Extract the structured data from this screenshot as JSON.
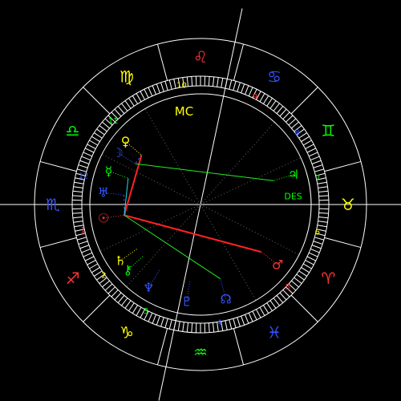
{
  "chart": {
    "ascendant_sign": "Scorpio",
    "signs": [
      {
        "name": "Aries",
        "glyph": "♈",
        "color": "#ff3333",
        "lon": 15
      },
      {
        "name": "Taurus",
        "glyph": "♉",
        "color": "#ffff00",
        "lon": 45
      },
      {
        "name": "Gemini",
        "glyph": "♊",
        "color": "#00ff00",
        "lon": 75
      },
      {
        "name": "Cancer",
        "glyph": "♋",
        "color": "#3355ff",
        "lon": 105
      },
      {
        "name": "Leo",
        "glyph": "♌",
        "color": "#ff3333",
        "lon": 135
      },
      {
        "name": "Virgo",
        "glyph": "♍",
        "color": "#ffff00",
        "lon": 165
      },
      {
        "name": "Libra",
        "glyph": "♎",
        "color": "#00ff00",
        "lon": 195
      },
      {
        "name": "Scorpio",
        "glyph": "♏",
        "color": "#3355ff",
        "lon": 225
      },
      {
        "name": "Sagittarius",
        "glyph": "♐",
        "color": "#ff3333",
        "lon": 255
      },
      {
        "name": "Capricorn",
        "glyph": "♑",
        "color": "#ffff00",
        "lon": 285
      },
      {
        "name": "Aquarius",
        "glyph": "♒",
        "color": "#00ff00",
        "lon": 315
      },
      {
        "name": "Pisces",
        "glyph": "♓",
        "color": "#3355ff",
        "lon": 345
      }
    ],
    "houses": [
      {
        "num": "1",
        "color": "#ff3333"
      },
      {
        "num": "2",
        "color": "#ffff00"
      },
      {
        "num": "3",
        "color": "#00ff00"
      },
      {
        "num": "4",
        "color": "#3355ff"
      },
      {
        "num": "5",
        "color": "#ff3333"
      },
      {
        "num": "6",
        "color": "#ffff00"
      },
      {
        "num": "7",
        "color": "#00ff00"
      },
      {
        "num": "8",
        "color": "#3355ff"
      },
      {
        "num": "9",
        "color": "#ff3333"
      },
      {
        "num": "10",
        "color": "#ffff00"
      },
      {
        "num": "11",
        "color": "#00ff00"
      },
      {
        "num": "12",
        "color": "#3355ff"
      }
    ],
    "angle_labels": [
      {
        "text": "MC",
        "color": "#ffff00",
        "role": "midheaven"
      },
      {
        "text": "DES",
        "color": "#00ff00",
        "role": "descendant"
      }
    ],
    "planets": [
      {
        "name": "Moon",
        "glyph": "☽",
        "color": "#3355ff"
      },
      {
        "name": "Venus",
        "glyph": "♀",
        "color": "#ffff00"
      },
      {
        "name": "Mercury",
        "glyph": "☿",
        "color": "#00ff00"
      },
      {
        "name": "Uranus",
        "glyph": "♅",
        "color": "#3355ff"
      },
      {
        "name": "Sun",
        "glyph": "☉",
        "color": "#ff3333"
      },
      {
        "name": "Saturn",
        "glyph": "♄",
        "color": "#ffff00"
      },
      {
        "name": "Chiron",
        "glyph": "⚷",
        "color": "#00ff00"
      },
      {
        "name": "Neptune",
        "glyph": "♆",
        "color": "#3355ff"
      },
      {
        "name": "Pluto",
        "glyph": "♇",
        "color": "#3355ff"
      },
      {
        "name": "Node",
        "glyph": "☊",
        "color": "#3355ff"
      },
      {
        "name": "Mars",
        "glyph": "♂",
        "color": "#ff3333"
      },
      {
        "name": "Jupiter",
        "glyph": "♃",
        "color": "#00ff00"
      }
    ],
    "aspects": [
      {
        "from": "Sun",
        "to": "Mars",
        "color": "#ff2222",
        "type": "square"
      },
      {
        "from": "Venus",
        "to": "Sun",
        "color": "#ff2222",
        "type": "square"
      },
      {
        "from": "Moon",
        "to": "Jupiter",
        "color": "#22ee22",
        "type": "sextile"
      },
      {
        "from": "Sun",
        "to": "Node",
        "color": "#22ee22",
        "type": "sextile"
      },
      {
        "from": "Mercury",
        "to": "Sun",
        "color": "#22dddd",
        "type": "opposition"
      },
      {
        "from": "Uranus",
        "to": "Sun",
        "color": "#4466ff",
        "type": "trine"
      },
      {
        "from": "Venus",
        "to": "Moon",
        "color": "#4466ff",
        "type": "minor"
      }
    ]
  }
}
